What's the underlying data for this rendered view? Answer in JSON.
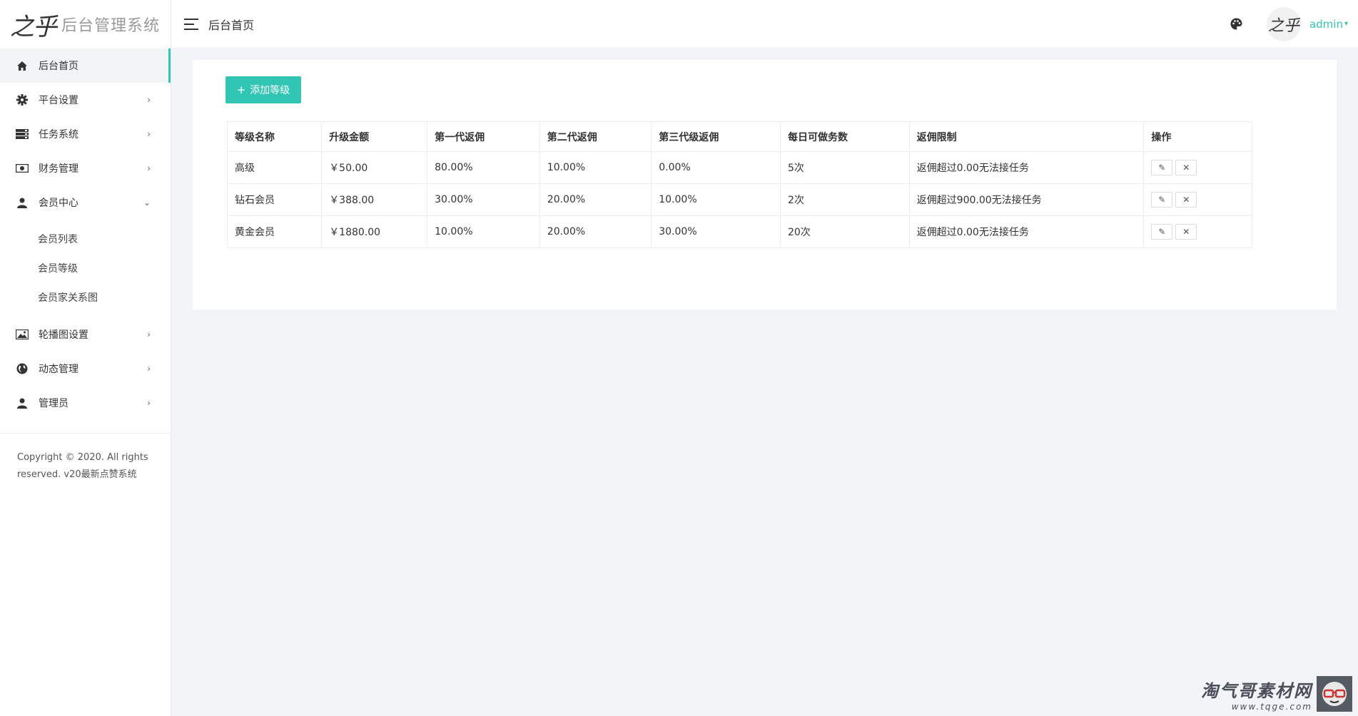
{
  "brand": {
    "mark": "之乎",
    "title": "后台管理系统"
  },
  "topbar": {
    "page_title": "后台首页",
    "avatar_text": "之乎",
    "user_name": "admin",
    "user_caret": "▾"
  },
  "sidebar": {
    "items": [
      {
        "label": "后台首页",
        "icon": "home-icon",
        "arrow": ""
      },
      {
        "label": "平台设置",
        "icon": "gear-icon",
        "arrow": "›"
      },
      {
        "label": "任务系统",
        "icon": "server-icon",
        "arrow": "›"
      },
      {
        "label": "财务管理",
        "icon": "money-icon",
        "arrow": "›"
      },
      {
        "label": "会员中心",
        "icon": "user-icon",
        "arrow": "⌄"
      },
      {
        "label": "轮播图设置",
        "icon": "image-icon",
        "arrow": "›"
      },
      {
        "label": "动态管理",
        "icon": "globe-icon",
        "arrow": "›"
      },
      {
        "label": "管理员",
        "icon": "user-icon",
        "arrow": "›"
      }
    ],
    "member_sub": [
      "会员列表",
      "会员等级",
      "会员家关系图"
    ],
    "copyright_line1": "Copyright © 2020. All rights",
    "copyright_line2": "reserved. v20最新点赞系统"
  },
  "main": {
    "add_button": "添加等级",
    "add_plus": "+",
    "columns": [
      "等级名称",
      "升级金额",
      "第一代返佣",
      "第二代返佣",
      "第三代级返佣",
      "每日可做务数",
      "返佣限制",
      "操作"
    ],
    "rows": [
      [
        "高级",
        "￥50.00",
        "80.00%",
        "10.00%",
        "0.00%",
        "5次",
        "返佣超过0.00无法接任务"
      ],
      [
        "钻石会员",
        "￥388.00",
        "30.00%",
        "20.00%",
        "10.00%",
        "2次",
        "返佣超过900.00无法接任务"
      ],
      [
        "黄金会员",
        "￥1880.00",
        "10.00%",
        "20.00%",
        "30.00%",
        "20次",
        "返佣超过0.00无法接任务"
      ]
    ],
    "edit_glyph": "✎",
    "delete_glyph": "✕"
  },
  "watermark": {
    "title": "淘气哥素材网",
    "url": "www.tqge.com"
  },
  "colors": {
    "accent": "#31c5b3",
    "background": "#f3f4f8"
  }
}
